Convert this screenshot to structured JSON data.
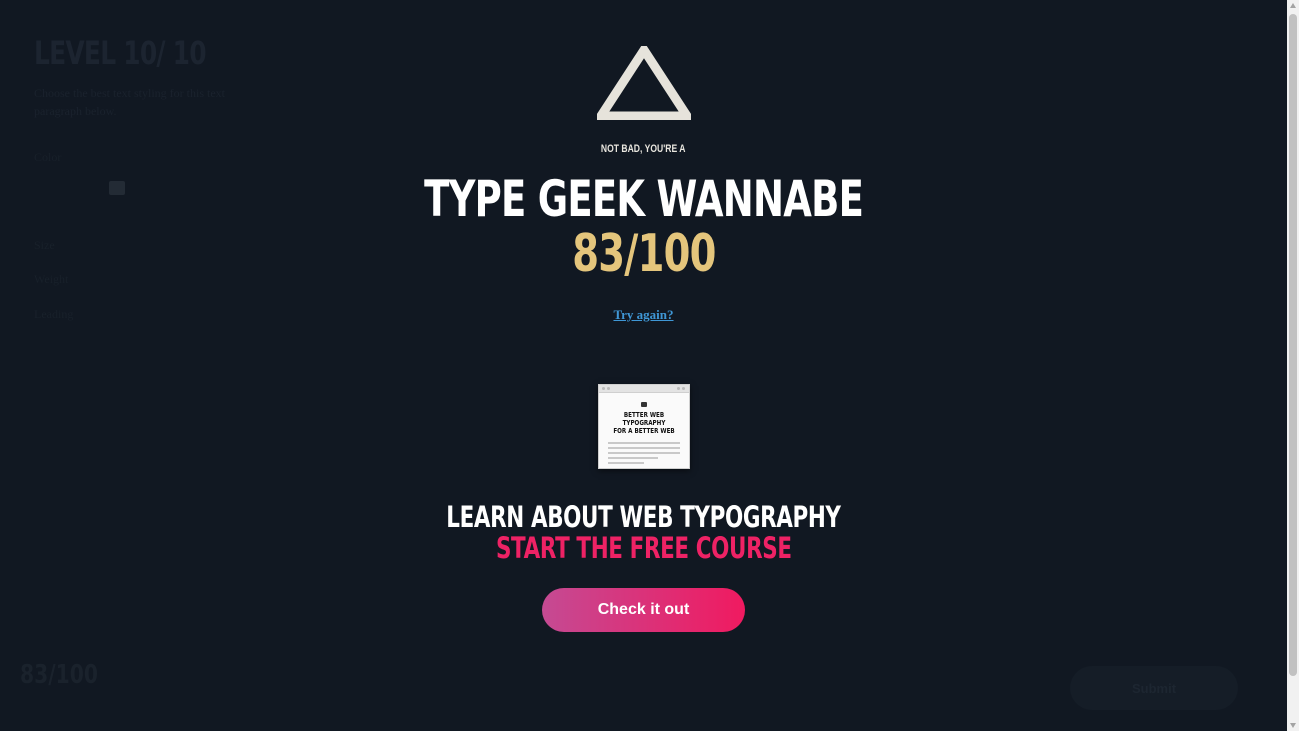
{
  "background": {
    "level_title": "LEVEL 10/ 10",
    "level_description": "Choose the best text styling for this text paragraph below.",
    "rows": [
      "Color",
      "Size",
      "Weight",
      "Leading"
    ],
    "score": "83/100",
    "submit_label": "Submit"
  },
  "result": {
    "icon": "triangle-icon",
    "kicker": "NOT BAD, YOU'RE A",
    "rank": "TYPE GEEK WANNABE",
    "score": "83/100",
    "try_again": "Try again?",
    "course_thumbnail": {
      "title_line1": "BETTER WEB TYPOGRAPHY",
      "title_line2": "FOR A BETTER WEB"
    },
    "learn_heading": "LEARN ABOUT WEB TYPOGRAPHY",
    "start_heading": "START THE FREE COURSE",
    "cta_label": "Check it out"
  },
  "colors": {
    "background": "#111822",
    "score_accent": "#e4c57c",
    "link": "#3f97d6",
    "course_accent": "#ee2265",
    "cta_gradient_start": "#c54a93",
    "cta_gradient_end": "#f01a60"
  }
}
